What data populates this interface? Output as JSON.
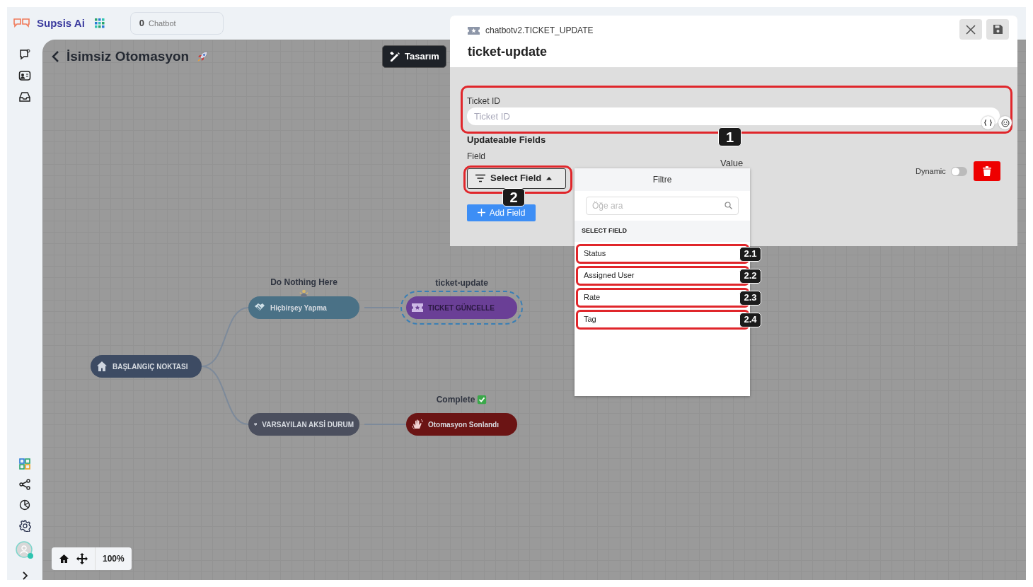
{
  "app": {
    "brand": "Supsis Ai",
    "chatbot_count": "0",
    "chatbot_label": "Chatbot"
  },
  "automation": {
    "title": "İsimsiz Otomasyon",
    "design_button": "Tasarım"
  },
  "nodes": [
    {
      "kind": "start",
      "label": "BAŞLANGIÇ NOKTASI",
      "color": "#3d4b63",
      "selected": false
    },
    {
      "kind": "action",
      "caption": "Do Nothing Here",
      "label": "Hiçbirşey Yapma",
      "color": "#4a7186",
      "selected": false
    },
    {
      "kind": "ticket",
      "caption": "ticket-update",
      "label": "TICKET GÜNCELLE",
      "color": "#6a3f96",
      "selected": true
    },
    {
      "kind": "fallback",
      "label": "VARSAYILAN AKSİ DURUM",
      "color": "#4b4f5e",
      "selected": false
    },
    {
      "kind": "end",
      "caption": "Complete",
      "label": "Otomasyon Sonlandı",
      "color": "#6b1414",
      "selected": false
    }
  ],
  "zoom": "100%",
  "panel": {
    "subtitle": "chatbotv2.TICKET_UPDATE",
    "title": "ticket-update",
    "ticket_id": {
      "label": "Ticket ID",
      "placeholder": "Ticket ID",
      "callout": "1"
    },
    "section": "Updateable Fields",
    "field_label": "Field",
    "select_button": "Select Field",
    "select_callout": "2",
    "value_label": "Value",
    "dynamic": {
      "label": "Dynamic",
      "on": false
    },
    "add_button": "Add Field"
  },
  "dropdown": {
    "header": "Filtre",
    "search_placeholder": "Öğe ara",
    "group": "SELECT FIELD",
    "options": [
      {
        "label": "Status",
        "callout": "2.1"
      },
      {
        "label": "Assigned User",
        "callout": "2.2"
      },
      {
        "label": "Rate",
        "callout": "2.3"
      },
      {
        "label": "Tag",
        "callout": "2.4"
      }
    ]
  }
}
